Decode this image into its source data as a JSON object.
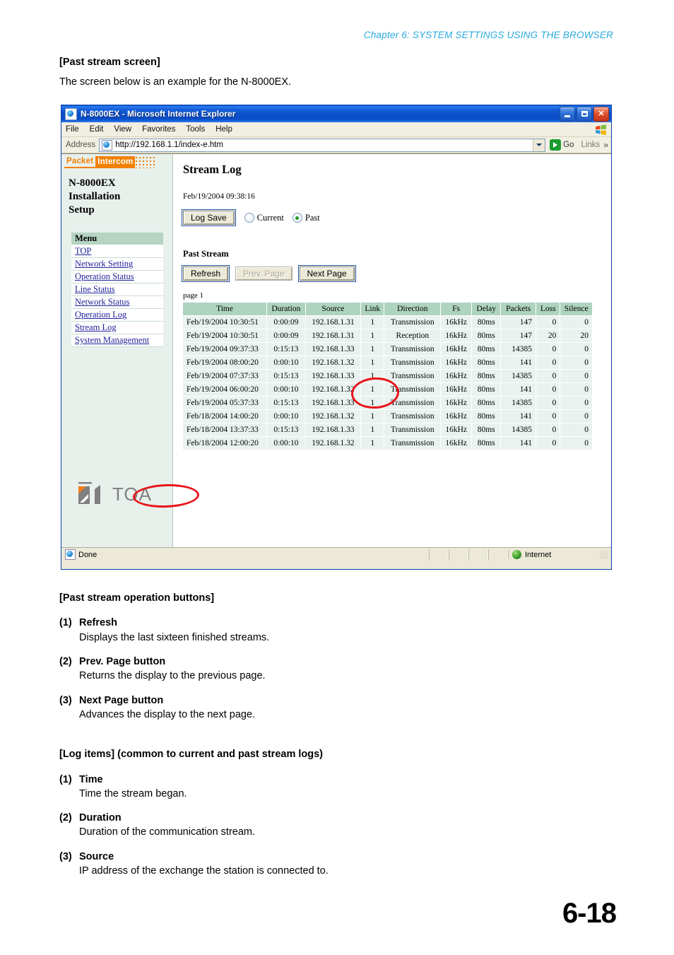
{
  "document": {
    "chapter_header": "Chapter 6:  SYSTEM SETTINGS USING THE BROWSER",
    "section_title": "[Past stream screen]",
    "section_intro": "The screen below is an example for the N-8000EX.",
    "page_number": "6-18",
    "ops_heading": "[Past stream operation buttons]",
    "ops_items": [
      {
        "num": "(1)",
        "label": "Refresh",
        "desc": "Displays the last sixteen finished streams."
      },
      {
        "num": "(2)",
        "label": "Prev. Page button",
        "desc": "Returns the display to the previous page."
      },
      {
        "num": "(3)",
        "label": "Next Page button",
        "desc": "Advances the display to the next page."
      }
    ],
    "log_heading": "[Log items] (common to current and past stream logs)",
    "log_items": [
      {
        "num": "(1)",
        "label": "Time",
        "desc": "Time the stream began."
      },
      {
        "num": "(2)",
        "label": "Duration",
        "desc": "Duration of the communication stream."
      },
      {
        "num": "(3)",
        "label": "Source",
        "desc": "IP address of the exchange the station is connected to."
      }
    ]
  },
  "browser": {
    "window_title": "N-8000EX - Microsoft Internet Explorer",
    "minimize_label": "Minimize",
    "maximize_label": "Maximize",
    "close_label": "Close",
    "menus": [
      "File",
      "Edit",
      "View",
      "Favorites",
      "Tools",
      "Help"
    ],
    "address_label": "Address",
    "address_url": "http://192.168.1.1/index-e.htm",
    "go_label": "Go",
    "links_label": "Links",
    "overflow_label": "»",
    "status_text": "Done",
    "status_zone": "Internet"
  },
  "sidebar": {
    "brand_packet": "Packet",
    "brand_intercom": "Intercom",
    "heading_lines": [
      "N-8000EX",
      "Installation",
      "Setup"
    ],
    "menu_header": "Menu",
    "menu_items": [
      "TOP",
      "Network Setting",
      "Operation Status",
      "Line Status",
      "Network Status",
      "Operation Log",
      "Stream Log",
      "System Management"
    ],
    "logo_text": "TOA"
  },
  "page": {
    "title": "Stream Log",
    "timestamp": "Feb/19/2004 09:38:16",
    "log_save_label": "Log Save",
    "radio_current_label": "Current",
    "radio_past_label": "Past",
    "radio_selected": "Past",
    "past_stream_heading": "Past Stream",
    "refresh_label": "Refresh",
    "prev_page_label": "Prev. Page",
    "prev_page_disabled": true,
    "next_page_label": "Next Page",
    "page_indicator": "page 1",
    "table": {
      "columns": [
        "Time",
        "Duration",
        "Source",
        "Link",
        "Direction",
        "Fs",
        "Delay",
        "Packets",
        "Loss",
        "Silence"
      ],
      "rows": [
        [
          "Feb/19/2004 10:30:51",
          "0:00:09",
          "192.168.1.31",
          "1",
          "Transmission",
          "16kHz",
          "80ms",
          "147",
          "0",
          "0"
        ],
        [
          "Feb/19/2004 10:30:51",
          "0:00:09",
          "192.168.1.31",
          "1",
          "Reception",
          "16kHz",
          "80ms",
          "147",
          "20",
          "20"
        ],
        [
          "Feb/19/2004 09:37:33",
          "0:15:13",
          "192.168.1.33",
          "1",
          "Transmission",
          "16kHz",
          "80ms",
          "14385",
          "0",
          "0"
        ],
        [
          "Feb/19/2004 08:00:20",
          "0:00:10",
          "192.168.1.32",
          "1",
          "Transmission",
          "16kHz",
          "80ms",
          "141",
          "0",
          "0"
        ],
        [
          "Feb/19/2004 07:37:33",
          "0:15:13",
          "192.168.1.33",
          "1",
          "Transmission",
          "16kHz",
          "80ms",
          "14385",
          "0",
          "0"
        ],
        [
          "Feb/19/2004 06:00:20",
          "0:00:10",
          "192.168.1.32",
          "1",
          "Transmission",
          "16kHz",
          "80ms",
          "141",
          "0",
          "0"
        ],
        [
          "Feb/19/2004 05:37:33",
          "0:15:13",
          "192.168.1.33",
          "1",
          "Transmission",
          "16kHz",
          "80ms",
          "14385",
          "0",
          "0"
        ],
        [
          "Feb/18/2004 14:00:20",
          "0:00:10",
          "192.168.1.32",
          "1",
          "Transmission",
          "16kHz",
          "80ms",
          "141",
          "0",
          "0"
        ],
        [
          "Feb/18/2004 13:37:33",
          "0:15:13",
          "192.168.1.33",
          "1",
          "Transmission",
          "16kHz",
          "80ms",
          "14385",
          "0",
          "0"
        ],
        [
          "Feb/18/2004 12:00:20",
          "0:00:10",
          "192.168.1.32",
          "1",
          "Transmission",
          "16kHz",
          "80ms",
          "141",
          "0",
          "0"
        ]
      ]
    }
  },
  "colors": {
    "header_blue": "#2aa9e0",
    "brand_orange": "#f28000",
    "table_header_green": "#aed3bf",
    "table_row_green": "#e9f2ee",
    "annotation_red": "#e8131a",
    "link_blue": "#22229b"
  }
}
